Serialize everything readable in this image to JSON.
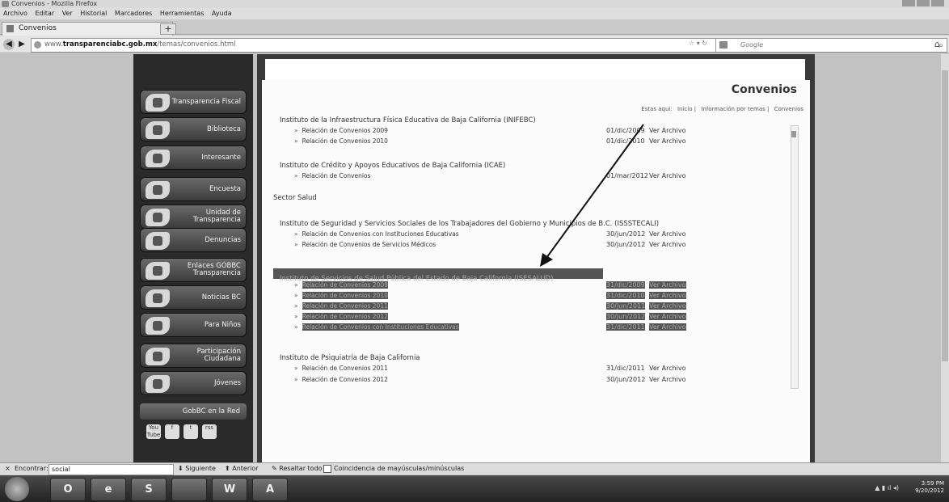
{
  "window": {
    "title": "Convenios - Mozilla Firefox",
    "menu": [
      "Archivo",
      "Editar",
      "Ver",
      "Historial",
      "Marcadores",
      "Herramientas",
      "Ayuda"
    ]
  },
  "tab": {
    "label": "Convenios",
    "new_tab": "+"
  },
  "address": {
    "prefix": "www.",
    "host": "transparenciabc.gob.mx",
    "path": "/temas/convenios.html"
  },
  "search": {
    "placeholder": "Google"
  },
  "sidebar": {
    "items": [
      {
        "label": "Transparencia Fiscal",
        "icon": "money-icon"
      },
      {
        "label": "Biblioteca",
        "icon": "book-icon"
      },
      {
        "label": "Interesante",
        "icon": "star-icon"
      },
      {
        "label": "Encuesta",
        "icon": "clipboard-icon"
      },
      {
        "label": "Unidad de Transparencia",
        "icon": "building-icon"
      },
      {
        "label": "Denuncias",
        "icon": "megaphone-icon"
      },
      {
        "label": "Enlaces GOBBC Transparencia",
        "icon": "link-icon"
      },
      {
        "label": "Noticias BC",
        "icon": "news-icon"
      },
      {
        "label": "Para Niños",
        "icon": "child-icon"
      },
      {
        "label": "Participación Ciudadana",
        "icon": "people-icon"
      },
      {
        "label": "Jóvenes",
        "icon": "youth-icon"
      }
    ],
    "network_label": "GobBC en la Red",
    "social": [
      "You Tube",
      "f",
      "t",
      "rss"
    ]
  },
  "main": {
    "title": "Convenios",
    "breadcrumb": {
      "prefix": "Estas aquí:",
      "items": [
        "Inicio",
        "Información por temas",
        "Convenios"
      ]
    },
    "sections": [
      {
        "institution": "Instituto de la Infraestructura Física Educativa de Baja California (INIFEBC)",
        "docs": [
          {
            "name": "Relación de Convenios 2009",
            "date": "01/dic/2009",
            "link": "Ver Archivo"
          },
          {
            "name": "Relación de Convenios 2010",
            "date": "01/dic/2010",
            "link": "Ver Archivo"
          }
        ]
      },
      {
        "institution": "Instituto de Crédito y Apoyos Educativos de Baja California (ICAE)",
        "docs": [
          {
            "name": "Relación de Convenios",
            "date": "01/mar/2012",
            "link": "Ver Archivo"
          }
        ]
      },
      {
        "heading": "Sector Salud"
      },
      {
        "institution": "Instituto de Seguridad y Servicios Sociales de los Trabajadores del Gobierno y Municipios de B.C. (ISSSTECALI)",
        "docs": [
          {
            "name": "Relación de Convenios con Instituciones Educativas",
            "date": "30/jun/2012",
            "link": "Ver Archivo"
          },
          {
            "name": "Relación de Convenios de Servicios Médicos",
            "date": "30/jun/2012",
            "link": "Ver Archivo"
          }
        ]
      },
      {
        "institution": "Instituto de Servicios de Salud Pública del Estado de Baja California (ISESALUD)",
        "highlighted": true,
        "docs": [
          {
            "name": "Relación de Convenios 2009",
            "date": "31/dic/2009",
            "link": "Ver Archivo"
          },
          {
            "name": "Relación de Convenios 2010",
            "date": "31/dic/2010",
            "link": "Ver Archivo"
          },
          {
            "name": "Relación de Convenios 2011",
            "date": "30/jun/2011",
            "link": "Ver Archivo"
          },
          {
            "name": "Relación de Convenios 2012",
            "date": "30/jun/2012",
            "link": "Ver Archivo"
          },
          {
            "name": "Relación de Convenios con Instituciones Educativas",
            "date": "31/dic/2011",
            "link": "Ver Archivo"
          }
        ]
      },
      {
        "institution": "Instituto de Psiquiatría de Baja California",
        "docs": [
          {
            "name": "Relación de Convenios 2011",
            "date": "31/dic/2011",
            "link": "Ver Archivo"
          },
          {
            "name": "Relación de Convenios 2012",
            "date": "30/jun/2012",
            "link": "Ver Archivo"
          }
        ]
      }
    ]
  },
  "findbar": {
    "close": "×",
    "label": "Encontrar:",
    "value": "social",
    "next": "Siguiente",
    "prev": "Anterior",
    "highlight_all": "Resaltar todo",
    "match_case": "Coincidencia de mayúsculas/minúsculas"
  },
  "taskbar": {
    "apps": [
      "O",
      "e",
      "S",
      "",
      "W",
      "A"
    ],
    "time": "3:59 PM",
    "date": "9/20/2012"
  },
  "colors": {
    "highlight": "#555555",
    "sidebar": "#2a2a2a",
    "accent_arrow": "#111111"
  }
}
